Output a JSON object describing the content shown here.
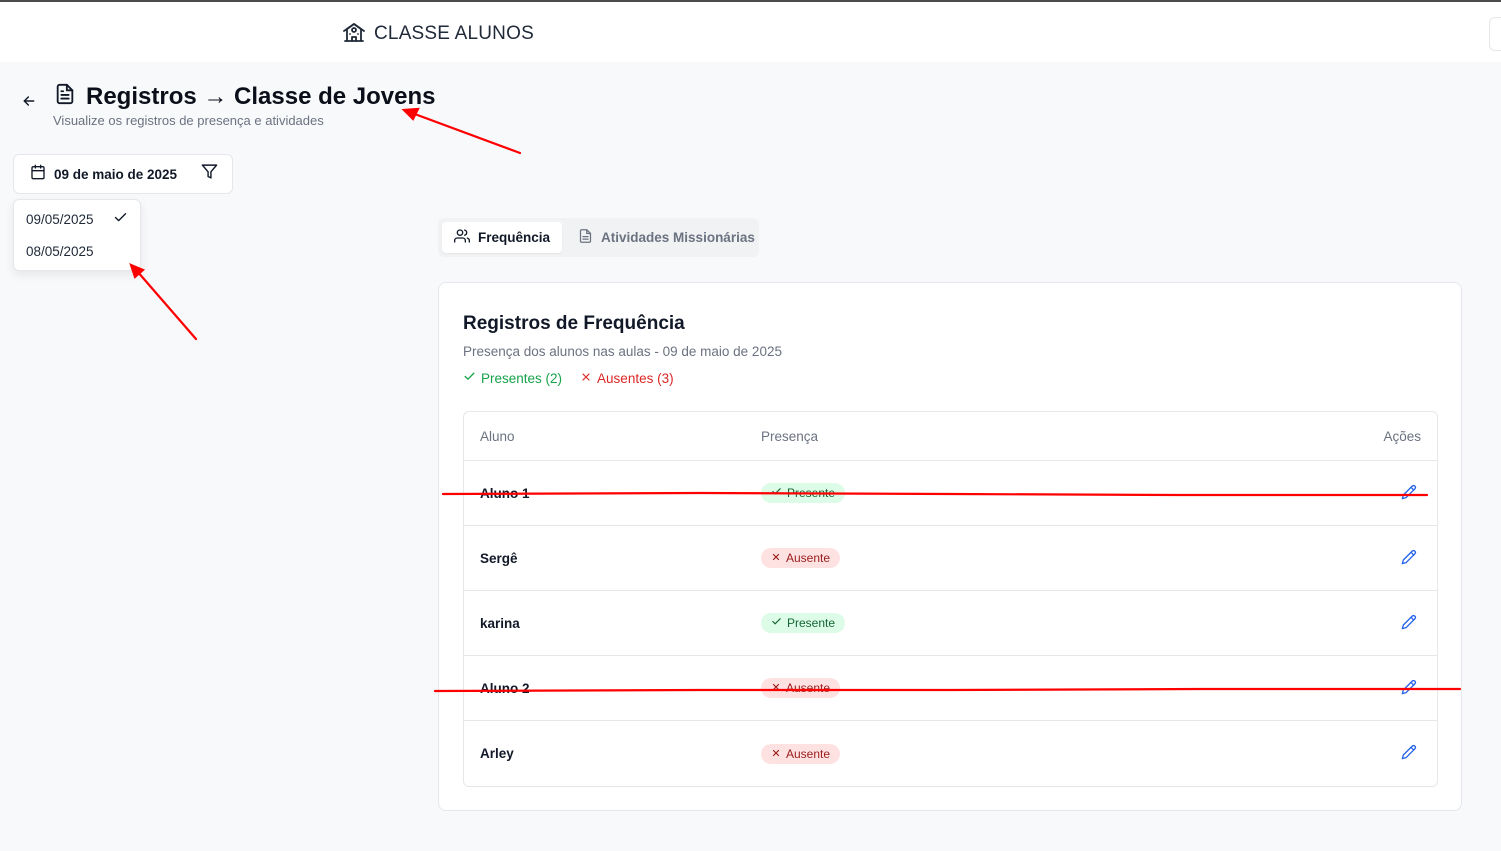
{
  "header": {
    "app_title": "CLASSE ALUNOS",
    "icon": "school-icon"
  },
  "page": {
    "title": "Registros → Classe de Jovens",
    "subtitle": "Visualize os registros de presença e atividades",
    "back_icon": "arrow-left-icon",
    "title_icon": "file-text-icon"
  },
  "date_filter": {
    "selected_label": "09 de maio de 2025",
    "options": [
      "09/05/2025",
      "08/05/2025"
    ],
    "selected_option": "09/05/2025"
  },
  "tabs": [
    {
      "label": "Frequência",
      "icon": "users-icon",
      "active": true
    },
    {
      "label": "Atividades Missionárias",
      "icon": "file-text-icon",
      "active": false
    }
  ],
  "card": {
    "title": "Registros de Frequência",
    "subtitle": "Presença dos alunos nas aulas - 09 de maio de 2025",
    "present_count_label": "Presentes (2)",
    "absent_count_label": "Ausentes (3)"
  },
  "table": {
    "headers": {
      "student": "Aluno",
      "attendance": "Presença",
      "actions": "Ações"
    },
    "rows": [
      {
        "name": "Aluno 1",
        "status": "Presente"
      },
      {
        "name": "Sergê",
        "status": "Ausente"
      },
      {
        "name": "karina",
        "status": "Presente"
      },
      {
        "name": "Aluno 2",
        "status": "Ausente"
      },
      {
        "name": "Arley",
        "status": "Ausente"
      }
    ]
  },
  "colors": {
    "present_text": "#16a34a",
    "absent_text": "#dc2626",
    "edit_icon": "#2563eb",
    "annotation": "#ff0000"
  }
}
